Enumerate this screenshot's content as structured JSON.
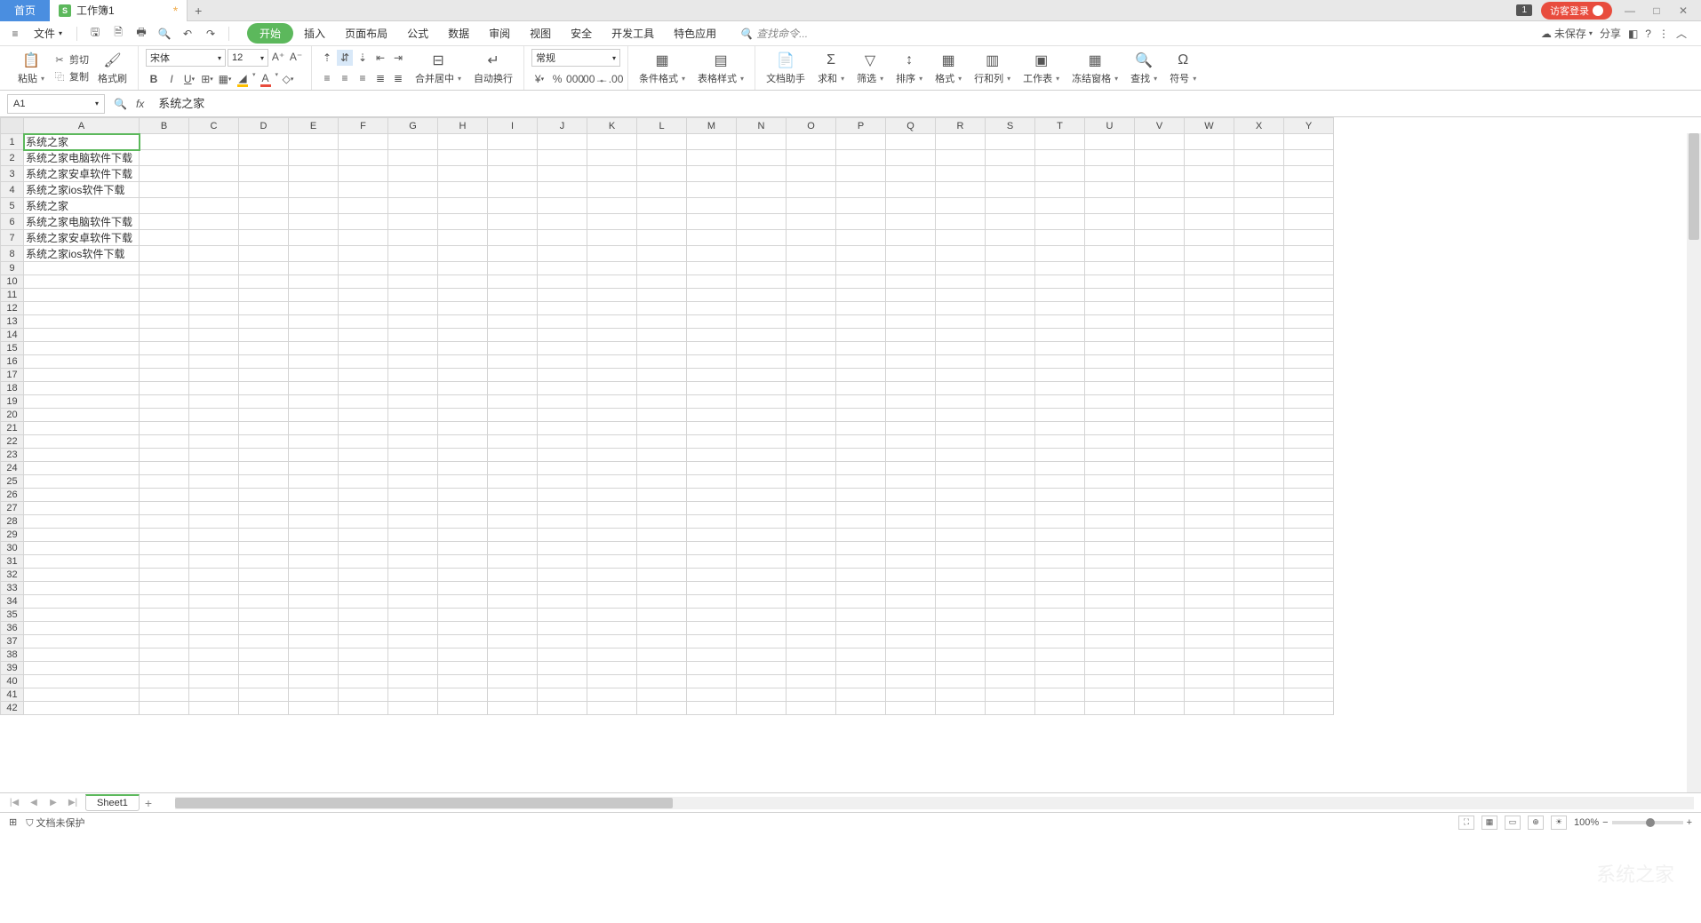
{
  "titlebar": {
    "home_tab": "首页",
    "doc_tab": "工作簿1",
    "sheet_icon": "S",
    "notif": "1",
    "login": "访客登录"
  },
  "menubar": {
    "file": "文件",
    "tabs": [
      "开始",
      "插入",
      "页面布局",
      "公式",
      "数据",
      "审阅",
      "视图",
      "安全",
      "开发工具",
      "特色应用"
    ],
    "active_index": 0,
    "search_placeholder": "查找命令...",
    "unsaved": "未保存",
    "share": "分享"
  },
  "ribbon": {
    "paste": "粘贴",
    "cut": "剪切",
    "copy": "复制",
    "format_painter": "格式刷",
    "font_name": "宋体",
    "font_size": "12",
    "merge_center": "合并居中",
    "wrap_text": "自动换行",
    "number_format": "常规",
    "cond_format": "条件格式",
    "table_style": "表格样式",
    "doc_assist": "文档助手",
    "sum": "求和",
    "filter": "筛选",
    "sort": "排序",
    "format": "格式",
    "row_col": "行和列",
    "worksheet": "工作表",
    "freeze": "冻结窗格",
    "find": "查找",
    "symbol": "符号"
  },
  "namebox": "A1",
  "formula": "系统之家",
  "columns": [
    "A",
    "B",
    "C",
    "D",
    "E",
    "F",
    "G",
    "H",
    "I",
    "J",
    "K",
    "L",
    "M",
    "N",
    "O",
    "P",
    "Q",
    "R",
    "S",
    "T",
    "U",
    "V",
    "W",
    "X",
    "Y"
  ],
  "selected_cell": "A1",
  "cells": {
    "A1": "系统之家",
    "A2": "系统之家电脑软件下载",
    "A3": "系统之家安卓软件下载",
    "A4": "系统之家ios软件下载",
    "A5": "系统之家",
    "A6": "系统之家电脑软件下载",
    "A7": "系统之家安卓软件下载",
    "A8": "系统之家ios软件下载"
  },
  "row_count": 42,
  "sheet_tab": "Sheet1",
  "status": {
    "protect": "文档未保护",
    "zoom": "100%"
  }
}
